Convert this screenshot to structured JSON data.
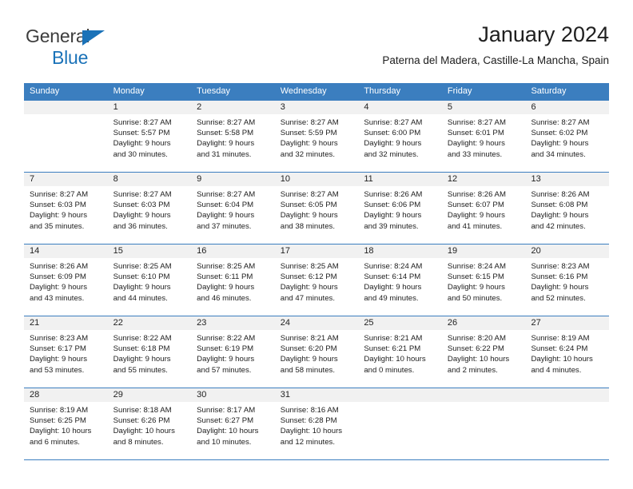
{
  "brand": {
    "name_line1": "General",
    "name_line2": "Blue",
    "color_dark": "#3d3d3d",
    "color_blue": "#1a72b8"
  },
  "header": {
    "title": "January 2024",
    "subtitle": "Paterna del Madera, Castille-La Mancha, Spain"
  },
  "theme": {
    "header_blue": "#3b7ebf",
    "day_band_gray": "#f1f1f1",
    "text": "#1d1d1d"
  },
  "weekdays": [
    "Sunday",
    "Monday",
    "Tuesday",
    "Wednesday",
    "Thursday",
    "Friday",
    "Saturday"
  ],
  "weeks": [
    [
      {
        "day": "",
        "sunrise": "",
        "sunset": "",
        "daylight_line1": "",
        "daylight_line2": ""
      },
      {
        "day": "1",
        "sunrise": "Sunrise: 8:27 AM",
        "sunset": "Sunset: 5:57 PM",
        "daylight_line1": "Daylight: 9 hours",
        "daylight_line2": "and 30 minutes."
      },
      {
        "day": "2",
        "sunrise": "Sunrise: 8:27 AM",
        "sunset": "Sunset: 5:58 PM",
        "daylight_line1": "Daylight: 9 hours",
        "daylight_line2": "and 31 minutes."
      },
      {
        "day": "3",
        "sunrise": "Sunrise: 8:27 AM",
        "sunset": "Sunset: 5:59 PM",
        "daylight_line1": "Daylight: 9 hours",
        "daylight_line2": "and 32 minutes."
      },
      {
        "day": "4",
        "sunrise": "Sunrise: 8:27 AM",
        "sunset": "Sunset: 6:00 PM",
        "daylight_line1": "Daylight: 9 hours",
        "daylight_line2": "and 32 minutes."
      },
      {
        "day": "5",
        "sunrise": "Sunrise: 8:27 AM",
        "sunset": "Sunset: 6:01 PM",
        "daylight_line1": "Daylight: 9 hours",
        "daylight_line2": "and 33 minutes."
      },
      {
        "day": "6",
        "sunrise": "Sunrise: 8:27 AM",
        "sunset": "Sunset: 6:02 PM",
        "daylight_line1": "Daylight: 9 hours",
        "daylight_line2": "and 34 minutes."
      }
    ],
    [
      {
        "day": "7",
        "sunrise": "Sunrise: 8:27 AM",
        "sunset": "Sunset: 6:03 PM",
        "daylight_line1": "Daylight: 9 hours",
        "daylight_line2": "and 35 minutes."
      },
      {
        "day": "8",
        "sunrise": "Sunrise: 8:27 AM",
        "sunset": "Sunset: 6:03 PM",
        "daylight_line1": "Daylight: 9 hours",
        "daylight_line2": "and 36 minutes."
      },
      {
        "day": "9",
        "sunrise": "Sunrise: 8:27 AM",
        "sunset": "Sunset: 6:04 PM",
        "daylight_line1": "Daylight: 9 hours",
        "daylight_line2": "and 37 minutes."
      },
      {
        "day": "10",
        "sunrise": "Sunrise: 8:27 AM",
        "sunset": "Sunset: 6:05 PM",
        "daylight_line1": "Daylight: 9 hours",
        "daylight_line2": "and 38 minutes."
      },
      {
        "day": "11",
        "sunrise": "Sunrise: 8:26 AM",
        "sunset": "Sunset: 6:06 PM",
        "daylight_line1": "Daylight: 9 hours",
        "daylight_line2": "and 39 minutes."
      },
      {
        "day": "12",
        "sunrise": "Sunrise: 8:26 AM",
        "sunset": "Sunset: 6:07 PM",
        "daylight_line1": "Daylight: 9 hours",
        "daylight_line2": "and 41 minutes."
      },
      {
        "day": "13",
        "sunrise": "Sunrise: 8:26 AM",
        "sunset": "Sunset: 6:08 PM",
        "daylight_line1": "Daylight: 9 hours",
        "daylight_line2": "and 42 minutes."
      }
    ],
    [
      {
        "day": "14",
        "sunrise": "Sunrise: 8:26 AM",
        "sunset": "Sunset: 6:09 PM",
        "daylight_line1": "Daylight: 9 hours",
        "daylight_line2": "and 43 minutes."
      },
      {
        "day": "15",
        "sunrise": "Sunrise: 8:25 AM",
        "sunset": "Sunset: 6:10 PM",
        "daylight_line1": "Daylight: 9 hours",
        "daylight_line2": "and 44 minutes."
      },
      {
        "day": "16",
        "sunrise": "Sunrise: 8:25 AM",
        "sunset": "Sunset: 6:11 PM",
        "daylight_line1": "Daylight: 9 hours",
        "daylight_line2": "and 46 minutes."
      },
      {
        "day": "17",
        "sunrise": "Sunrise: 8:25 AM",
        "sunset": "Sunset: 6:12 PM",
        "daylight_line1": "Daylight: 9 hours",
        "daylight_line2": "and 47 minutes."
      },
      {
        "day": "18",
        "sunrise": "Sunrise: 8:24 AM",
        "sunset": "Sunset: 6:14 PM",
        "daylight_line1": "Daylight: 9 hours",
        "daylight_line2": "and 49 minutes."
      },
      {
        "day": "19",
        "sunrise": "Sunrise: 8:24 AM",
        "sunset": "Sunset: 6:15 PM",
        "daylight_line1": "Daylight: 9 hours",
        "daylight_line2": "and 50 minutes."
      },
      {
        "day": "20",
        "sunrise": "Sunrise: 8:23 AM",
        "sunset": "Sunset: 6:16 PM",
        "daylight_line1": "Daylight: 9 hours",
        "daylight_line2": "and 52 minutes."
      }
    ],
    [
      {
        "day": "21",
        "sunrise": "Sunrise: 8:23 AM",
        "sunset": "Sunset: 6:17 PM",
        "daylight_line1": "Daylight: 9 hours",
        "daylight_line2": "and 53 minutes."
      },
      {
        "day": "22",
        "sunrise": "Sunrise: 8:22 AM",
        "sunset": "Sunset: 6:18 PM",
        "daylight_line1": "Daylight: 9 hours",
        "daylight_line2": "and 55 minutes."
      },
      {
        "day": "23",
        "sunrise": "Sunrise: 8:22 AM",
        "sunset": "Sunset: 6:19 PM",
        "daylight_line1": "Daylight: 9 hours",
        "daylight_line2": "and 57 minutes."
      },
      {
        "day": "24",
        "sunrise": "Sunrise: 8:21 AM",
        "sunset": "Sunset: 6:20 PM",
        "daylight_line1": "Daylight: 9 hours",
        "daylight_line2": "and 58 minutes."
      },
      {
        "day": "25",
        "sunrise": "Sunrise: 8:21 AM",
        "sunset": "Sunset: 6:21 PM",
        "daylight_line1": "Daylight: 10 hours",
        "daylight_line2": "and 0 minutes."
      },
      {
        "day": "26",
        "sunrise": "Sunrise: 8:20 AM",
        "sunset": "Sunset: 6:22 PM",
        "daylight_line1": "Daylight: 10 hours",
        "daylight_line2": "and 2 minutes."
      },
      {
        "day": "27",
        "sunrise": "Sunrise: 8:19 AM",
        "sunset": "Sunset: 6:24 PM",
        "daylight_line1": "Daylight: 10 hours",
        "daylight_line2": "and 4 minutes."
      }
    ],
    [
      {
        "day": "28",
        "sunrise": "Sunrise: 8:19 AM",
        "sunset": "Sunset: 6:25 PM",
        "daylight_line1": "Daylight: 10 hours",
        "daylight_line2": "and 6 minutes."
      },
      {
        "day": "29",
        "sunrise": "Sunrise: 8:18 AM",
        "sunset": "Sunset: 6:26 PM",
        "daylight_line1": "Daylight: 10 hours",
        "daylight_line2": "and 8 minutes."
      },
      {
        "day": "30",
        "sunrise": "Sunrise: 8:17 AM",
        "sunset": "Sunset: 6:27 PM",
        "daylight_line1": "Daylight: 10 hours",
        "daylight_line2": "and 10 minutes."
      },
      {
        "day": "31",
        "sunrise": "Sunrise: 8:16 AM",
        "sunset": "Sunset: 6:28 PM",
        "daylight_line1": "Daylight: 10 hours",
        "daylight_line2": "and 12 minutes."
      },
      {
        "day": "",
        "sunrise": "",
        "sunset": "",
        "daylight_line1": "",
        "daylight_line2": ""
      },
      {
        "day": "",
        "sunrise": "",
        "sunset": "",
        "daylight_line1": "",
        "daylight_line2": ""
      },
      {
        "day": "",
        "sunrise": "",
        "sunset": "",
        "daylight_line1": "",
        "daylight_line2": ""
      }
    ]
  ]
}
